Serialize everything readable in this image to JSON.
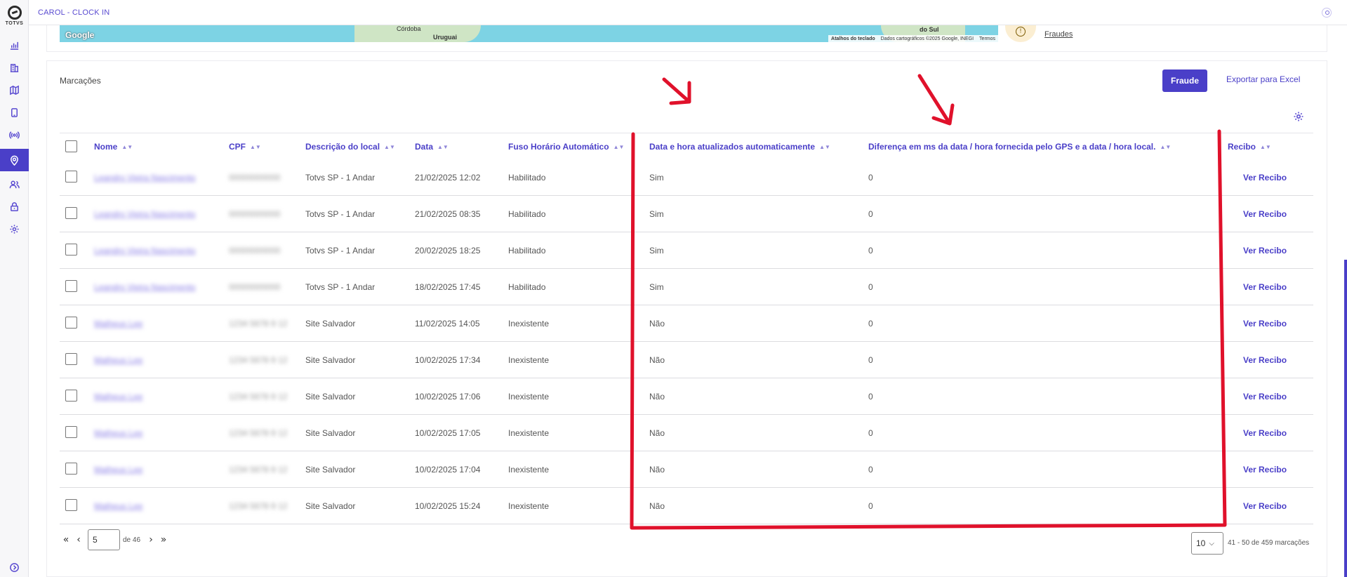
{
  "app": {
    "title": "CAROL - CLOCK IN",
    "brand": "TOTVS"
  },
  "map": {
    "labels": [
      "Córdoba",
      "Uruguai",
      "do Sul"
    ],
    "attrib": [
      "Atalhos do teclado",
      "Dados cartográficos ©2025 Google, INEGI",
      "Termos"
    ],
    "google": "Google"
  },
  "fraud": {
    "link": "Fraudes"
  },
  "card": {
    "title": "Marcações",
    "fraud_button": "Fraude",
    "export_button": "Exportar para Excel"
  },
  "table": {
    "headers": {
      "nome": "Nome",
      "cpf": "CPF",
      "local": "Descrição do local",
      "data": "Data",
      "fuso": "Fuso Horário Automático",
      "auto": "Data e hora atualizados automaticamente",
      "diff": "Diferença em ms da data / hora fornecida pelo GPS e a data / hora local.",
      "recibo": "Recibo"
    },
    "recibo_label": "Ver Recibo",
    "rows": [
      {
        "nome": "Leandro Vieira Nascimento",
        "cpf": "00000000000",
        "local": "Totvs SP - 1 Andar",
        "data": "21/02/2025 12:02",
        "fuso": "Habilitado",
        "auto": "Sim",
        "diff": "0"
      },
      {
        "nome": "Leandro Vieira Nascimento",
        "cpf": "00000000000",
        "local": "Totvs SP - 1 Andar",
        "data": "21/02/2025 08:35",
        "fuso": "Habilitado",
        "auto": "Sim",
        "diff": "0"
      },
      {
        "nome": "Leandro Vieira Nascimento",
        "cpf": "00000000000",
        "local": "Totvs SP - 1 Andar",
        "data": "20/02/2025 18:25",
        "fuso": "Habilitado",
        "auto": "Sim",
        "diff": "0"
      },
      {
        "nome": "Leandro Vieira Nascimento",
        "cpf": "00000000000",
        "local": "Totvs SP - 1 Andar",
        "data": "18/02/2025 17:45",
        "fuso": "Habilitado",
        "auto": "Sim",
        "diff": "0"
      },
      {
        "nome": "Matheus Lee",
        "cpf": "1234 5678 9 12",
        "local": "Site Salvador",
        "data": "11/02/2025 14:05",
        "fuso": "Inexistente",
        "auto": "Não",
        "diff": "0"
      },
      {
        "nome": "Matheus Lee",
        "cpf": "1234 5678 9 12",
        "local": "Site Salvador",
        "data": "10/02/2025 17:34",
        "fuso": "Inexistente",
        "auto": "Não",
        "diff": "0"
      },
      {
        "nome": "Matheus Lee",
        "cpf": "1234 5678 9 12",
        "local": "Site Salvador",
        "data": "10/02/2025 17:06",
        "fuso": "Inexistente",
        "auto": "Não",
        "diff": "0"
      },
      {
        "nome": "Matheus Lee",
        "cpf": "1234 5678 9 12",
        "local": "Site Salvador",
        "data": "10/02/2025 17:05",
        "fuso": "Inexistente",
        "auto": "Não",
        "diff": "0"
      },
      {
        "nome": "Matheus Lee",
        "cpf": "1234 5678 9 12",
        "local": "Site Salvador",
        "data": "10/02/2025 17:04",
        "fuso": "Inexistente",
        "auto": "Não",
        "diff": "0"
      },
      {
        "nome": "Matheus Lee",
        "cpf": "1234 5678 9 12",
        "local": "Site Salvador",
        "data": "10/02/2025 15:24",
        "fuso": "Inexistente",
        "auto": "Não",
        "diff": "0"
      }
    ]
  },
  "pagination": {
    "current_page": "5",
    "of_label": "de 46",
    "per_page": "10",
    "count_label": "41 - 50 de 459 marcações"
  },
  "colors": {
    "accent": "#4a3fc8",
    "annotation": "#e0112b"
  },
  "icons": [
    "first-page-icon",
    "prev-page-icon",
    "next-page-icon",
    "last-page-icon",
    "gear-icon",
    "user-icon"
  ]
}
